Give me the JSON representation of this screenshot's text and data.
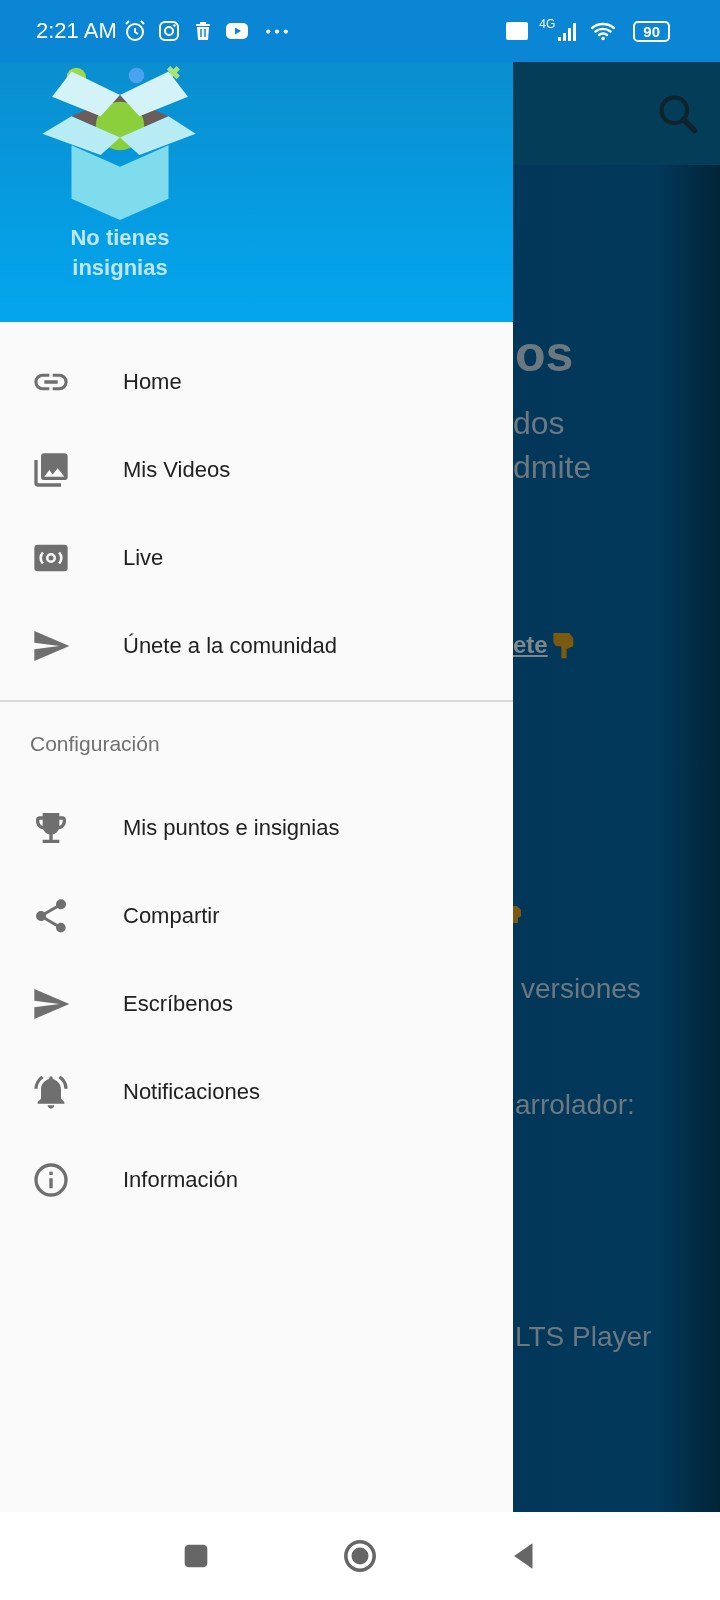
{
  "status_bar": {
    "time": "2:21 AM",
    "battery": "90",
    "network": "4G"
  },
  "drawer": {
    "badges_message": "No tienes insignias",
    "items": [
      {
        "kind": "link",
        "label": "Home"
      },
      {
        "kind": "photos",
        "label": "Mis Videos"
      },
      {
        "kind": "live",
        "label": "Live"
      },
      {
        "kind": "send",
        "label": "Únete a la comunidad"
      }
    ],
    "section_title": "Configuración",
    "settings_items": [
      {
        "kind": "trophy",
        "label": "Mis puntos e insignias"
      },
      {
        "kind": "share",
        "label": "Compartir"
      },
      {
        "kind": "send",
        "label": "Escríbenos"
      },
      {
        "kind": "bell",
        "label": "Notificaciones"
      },
      {
        "kind": "info",
        "label": "Información"
      }
    ]
  },
  "background_page": {
    "heading": "os",
    "lines": [
      "dos",
      "dmite"
    ],
    "link": "ete",
    "texts": [
      "versiones",
      "arrolador:",
      "LTS Player"
    ]
  }
}
